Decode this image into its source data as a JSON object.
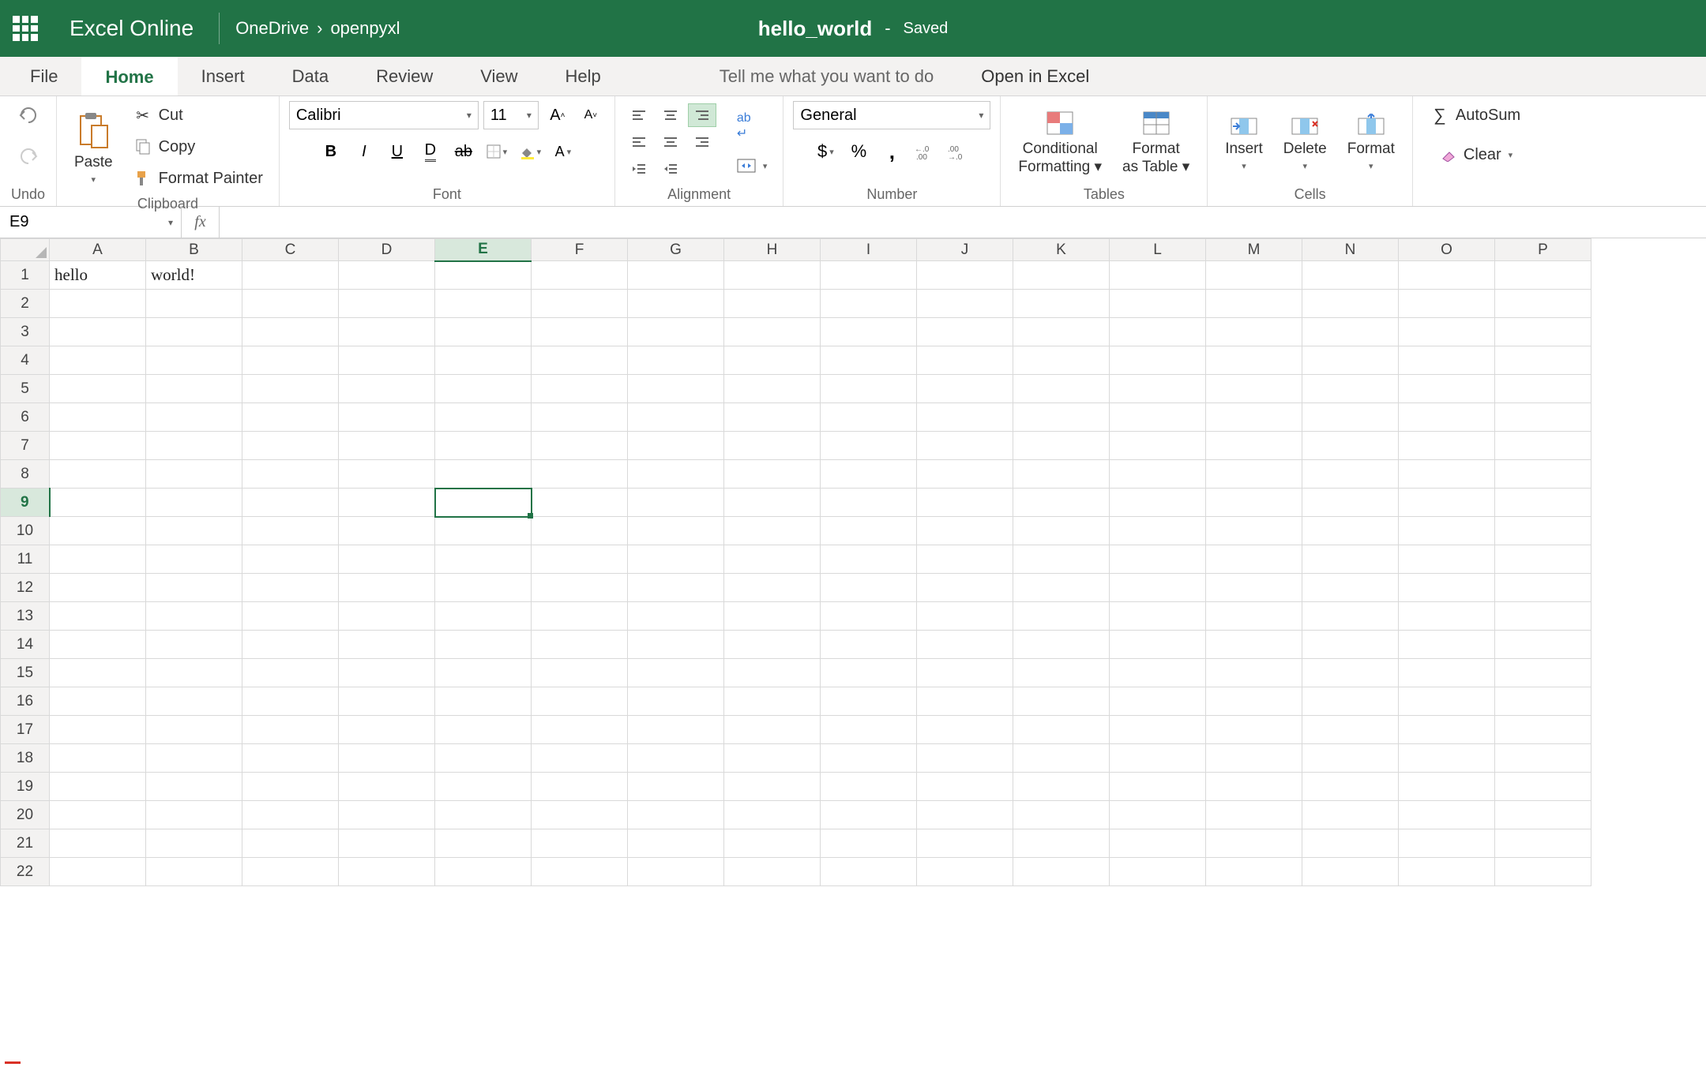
{
  "header": {
    "app_name": "Excel Online",
    "breadcrumb": [
      "OneDrive",
      "openpyxl"
    ],
    "doc_name": "hello_world",
    "saved_status": "Saved"
  },
  "tabs": {
    "items": [
      "File",
      "Home",
      "Insert",
      "Data",
      "Review",
      "View",
      "Help"
    ],
    "active": "Home",
    "tell_me": "Tell me what you want to do",
    "open_in_excel": "Open in Excel"
  },
  "ribbon": {
    "undo": {
      "label": "Undo"
    },
    "clipboard": {
      "paste": "Paste",
      "cut": "Cut",
      "copy": "Copy",
      "format_painter": "Format Painter",
      "label": "Clipboard"
    },
    "font": {
      "name": "Calibri",
      "size": "11",
      "label": "Font"
    },
    "alignment": {
      "wrap": "ab",
      "label": "Alignment"
    },
    "number": {
      "format": "General",
      "label": "Number"
    },
    "tables": {
      "conditional": "Conditional Formatting",
      "as_table": "Format as Table",
      "label": "Tables"
    },
    "cells": {
      "insert": "Insert",
      "delete": "Delete",
      "format": "Format",
      "label": "Cells"
    },
    "editing": {
      "autosum": "AutoSum",
      "clear": "Clear"
    }
  },
  "formula_bar": {
    "name_box": "E9",
    "fx": "fx",
    "formula": ""
  },
  "grid": {
    "columns": [
      "A",
      "B",
      "C",
      "D",
      "E",
      "F",
      "G",
      "H",
      "I",
      "J",
      "K",
      "L",
      "M",
      "N",
      "O",
      "P"
    ],
    "rows": 22,
    "selected_cell": {
      "col": "E",
      "row": 9
    },
    "cells": {
      "A1": "hello",
      "B1": "world!"
    }
  }
}
